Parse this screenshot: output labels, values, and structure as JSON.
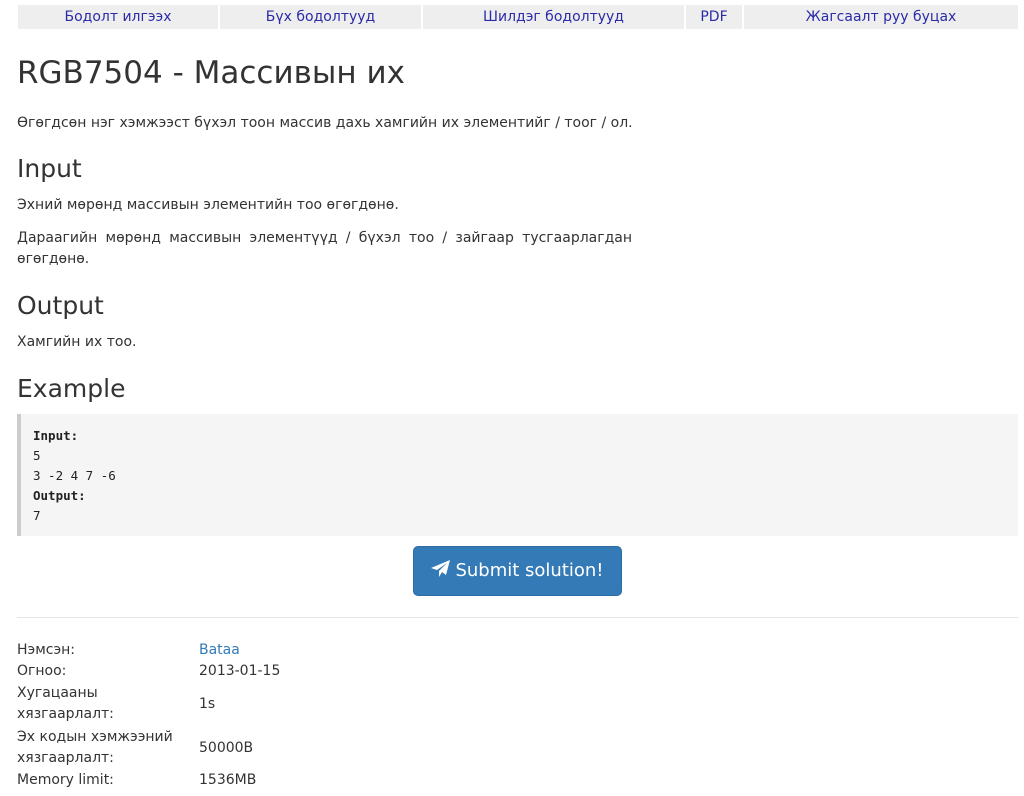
{
  "nav": {
    "tabs": [
      {
        "label": "Бодолт илгээх"
      },
      {
        "label": "Бүх бодолтууд"
      },
      {
        "label": "Шилдэг бодолтууд"
      },
      {
        "label": "PDF"
      },
      {
        "label": "Жагсаалт руу буцах"
      }
    ]
  },
  "problem": {
    "title": "RGB7504 - Массивын их",
    "description": "Өгөгдсөн нэг хэмжээст бүхэл тоон массив дахь хамгийн их элементийг / тоог / ол.",
    "input_heading": "Input",
    "input_text_1": "Эхний мөрөнд массивын элементийн тоо өгөгдөнө.",
    "input_text_2": "Дараагийн мөрөнд массивын элементүүд / бүхэл тоо / зайгаар тусгаарлагдан өгөгдөнө.",
    "output_heading": "Output",
    "output_text": "Хамгийн их тоо.",
    "example_heading": "Example",
    "example": {
      "input_label": "Input:",
      "input_line_1": "5",
      "input_line_2": "3 -2 4 7 -6",
      "output_label": "Output:",
      "output_line_1": "7"
    }
  },
  "submit": {
    "label": "Submit solution!",
    "icon": "paper-plane-icon",
    "color": "#337ab7"
  },
  "meta": {
    "author_key": "Нэмсэн:",
    "author_value": "Bataa",
    "date_key": "Огноо:",
    "date_value": "2013-01-15",
    "time_limit_key_1": "Хугацааны",
    "time_limit_key_2": "хязгаарлалт:",
    "time_limit_value": "1s",
    "source_limit_key_1": "Эх кодын хэмжээний",
    "source_limit_key_2": "хязгаарлалт:",
    "source_limit_value": "50000B",
    "memory_limit_key": "Memory limit:",
    "memory_limit_value": "1536MB"
  }
}
